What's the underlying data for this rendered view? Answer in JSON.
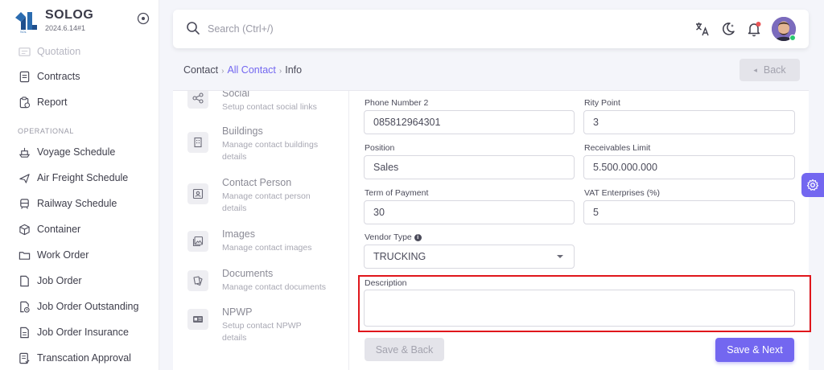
{
  "brand": {
    "name": "SOLOG",
    "version": "2024.6.14#1",
    "logo_text": "SOL"
  },
  "sidebar": {
    "items_top": [
      {
        "label": "Quotation",
        "icon": "quotation-icon"
      },
      {
        "label": "Contracts",
        "icon": "contracts-icon"
      },
      {
        "label": "Report",
        "icon": "report-icon"
      }
    ],
    "section_label": "OPERATIONAL",
    "items": [
      {
        "label": "Voyage Schedule",
        "icon": "ship-icon"
      },
      {
        "label": "Air Freight Schedule",
        "icon": "plane-icon"
      },
      {
        "label": "Railway Schedule",
        "icon": "train-icon"
      },
      {
        "label": "Container",
        "icon": "container-icon"
      },
      {
        "label": "Work Order",
        "icon": "folder-icon"
      },
      {
        "label": "Job Order",
        "icon": "file-icon"
      },
      {
        "label": "Job Order Outstanding",
        "icon": "file-clock-icon"
      },
      {
        "label": "Job Order Insurance",
        "icon": "file-text-icon"
      },
      {
        "label": "Transcation Approval",
        "icon": "approval-icon"
      }
    ]
  },
  "search": {
    "placeholder": "Search (Ctrl+/)"
  },
  "breadcrumb": {
    "root": "Contact",
    "link": "All Contact",
    "current": "Info"
  },
  "back_button": {
    "label": "Back"
  },
  "side_menu": [
    {
      "title": "Social",
      "desc": "Setup contact social links",
      "icon": "share-icon"
    },
    {
      "title": "Buildings",
      "desc": "Manage contact buildings details",
      "icon": "building-icon"
    },
    {
      "title": "Contact Person",
      "desc": "Manage contact person details",
      "icon": "contact-person-icon"
    },
    {
      "title": "Images",
      "desc": "Manage contact images",
      "icon": "image-icon"
    },
    {
      "title": "Documents",
      "desc": "Manage contact documents",
      "icon": "documents-icon"
    },
    {
      "title": "NPWP",
      "desc": "Setup contact NPWP details",
      "icon": "id-card-icon"
    }
  ],
  "form": {
    "phone2": {
      "label": "Phone Number 2",
      "value": "085812964301"
    },
    "rity_point": {
      "label": "Rity Point",
      "value": "3"
    },
    "position": {
      "label": "Position",
      "value": "Sales"
    },
    "receivables_limit": {
      "label": "Receivables Limit",
      "value": "5.500.000.000"
    },
    "term_of_payment": {
      "label": "Term of Payment",
      "value": "30"
    },
    "vat_enterprises": {
      "label": "VAT Enterprises (%)",
      "value": "5"
    },
    "vendor_type": {
      "label": "Vendor Type",
      "value": "TRUCKING"
    },
    "description": {
      "label": "Description",
      "value": ""
    }
  },
  "buttons": {
    "save_back": "Save & Back",
    "save_next": "Save & Next"
  },
  "colors": {
    "accent": "#7367f0",
    "highlight": "#e0161b",
    "online": "#28c76f",
    "notification": "#ea5455"
  }
}
